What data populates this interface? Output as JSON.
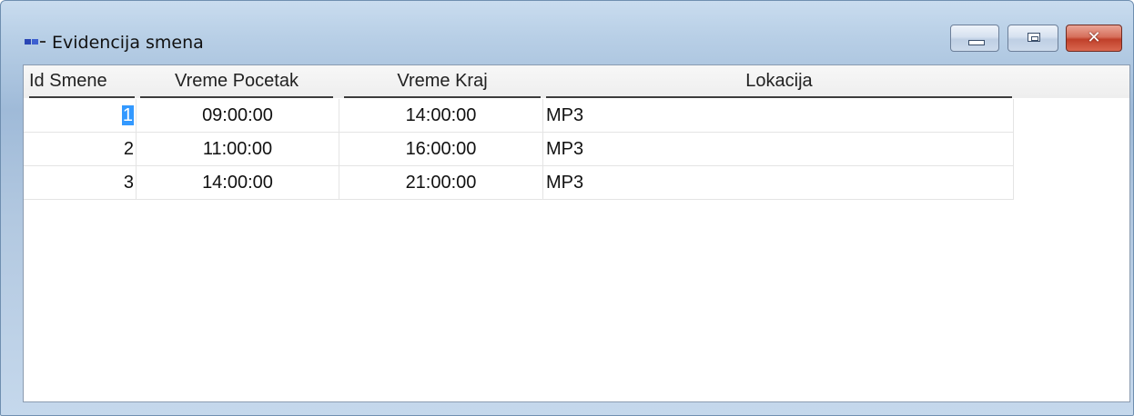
{
  "window": {
    "title": "Evidencija smena",
    "controls": [
      "minimize",
      "maximize",
      "close"
    ],
    "close_symbol": "✕"
  },
  "grid": {
    "columns": [
      "Id Smene",
      "Vreme Pocetak",
      "Vreme Kraj",
      "Lokacija"
    ],
    "rows": [
      {
        "id": "1",
        "start": "09:00:00",
        "end": "14:00:00",
        "location": "MP3"
      },
      {
        "id": "2",
        "start": "11:00:00",
        "end": "16:00:00",
        "location": "MP3"
      },
      {
        "id": "3",
        "start": "14:00:00",
        "end": "21:00:00",
        "location": "MP3"
      }
    ],
    "selected_cell": "row 1, Id Smene"
  },
  "colors": {
    "selection": "#3399ff",
    "frame": "#b8cfe6",
    "close_button": "#c0402a"
  },
  "icons": [
    "app-icon",
    "minimize-icon",
    "maximize-icon",
    "close-icon"
  ]
}
